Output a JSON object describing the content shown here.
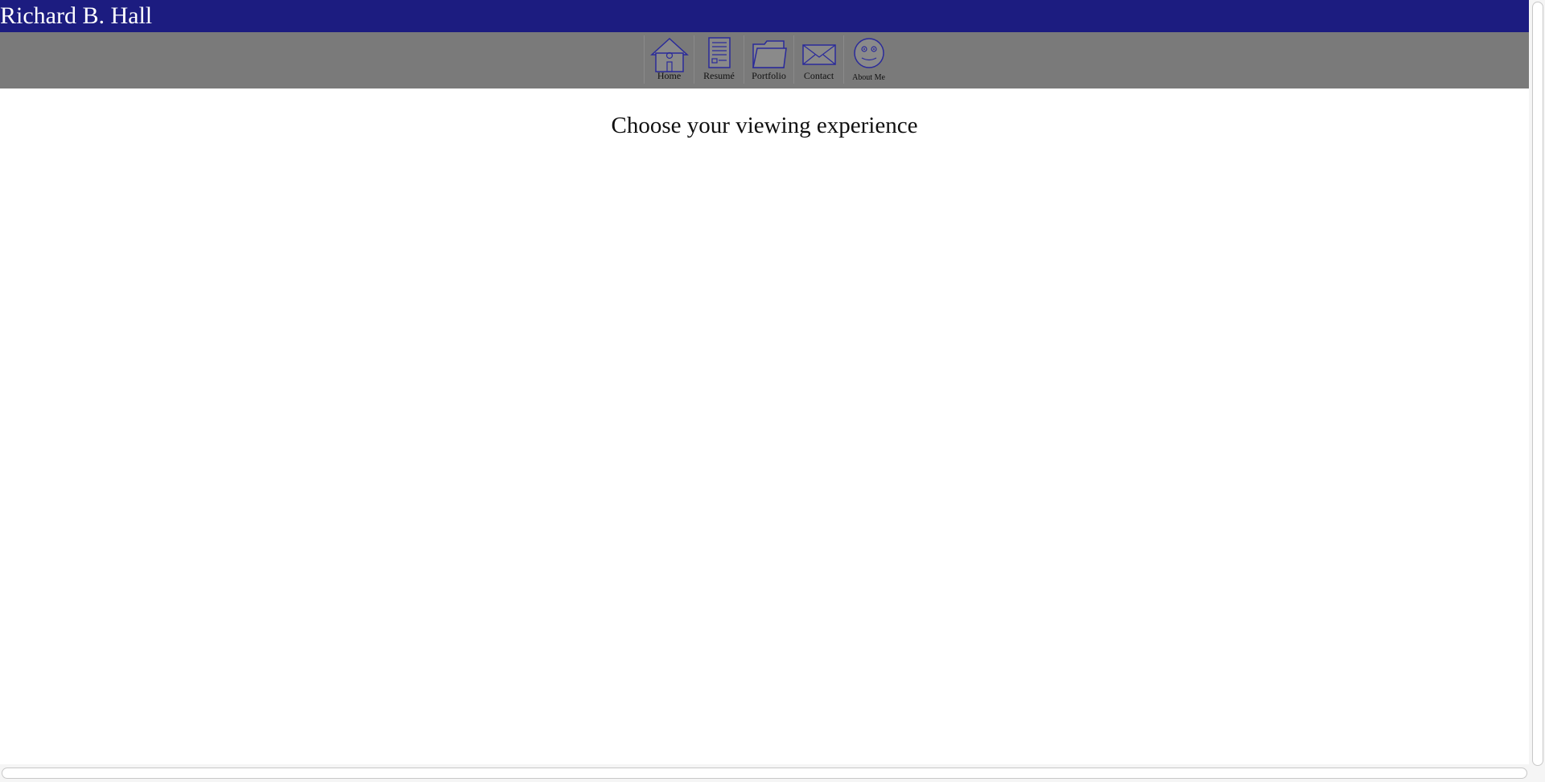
{
  "header": {
    "title": "Richard B. Hall",
    "background_color": "#1c1c80",
    "text_color": "#ffffff"
  },
  "nav": {
    "background_color": "#7a7a7a",
    "icon_color": "#2a2a9a",
    "items": [
      {
        "label": "Home",
        "icon": "home-icon"
      },
      {
        "label": "Resumé",
        "icon": "document-icon"
      },
      {
        "label": "Portfolio",
        "icon": "folder-icon"
      },
      {
        "label": "Contact",
        "icon": "envelope-icon"
      },
      {
        "label": "About Me",
        "icon": "smiley-face-icon"
      }
    ]
  },
  "main": {
    "heading": "Choose your viewing experience"
  }
}
